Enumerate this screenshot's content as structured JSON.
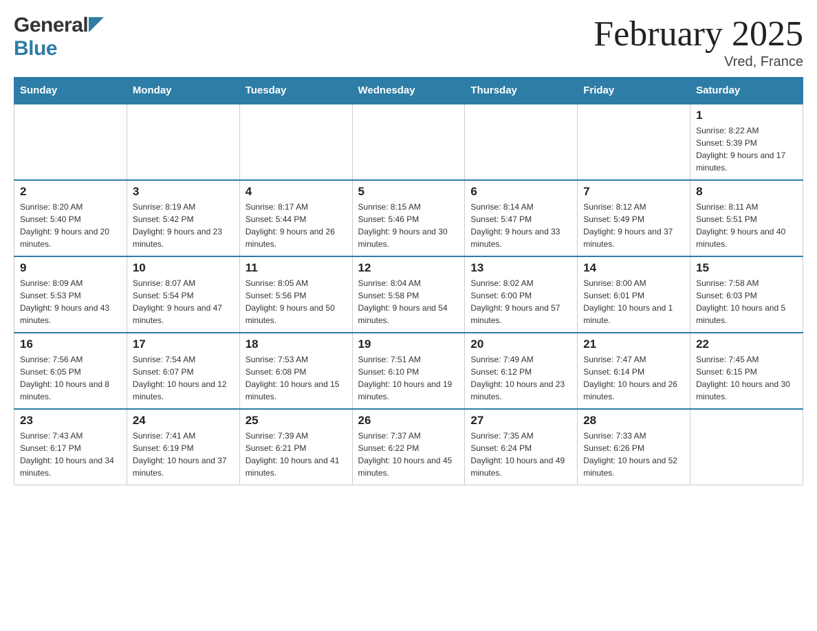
{
  "header": {
    "logo_general": "General",
    "logo_blue": "Blue",
    "month_title": "February 2025",
    "location": "Vred, France"
  },
  "days_of_week": [
    "Sunday",
    "Monday",
    "Tuesday",
    "Wednesday",
    "Thursday",
    "Friday",
    "Saturday"
  ],
  "weeks": [
    [
      {
        "day": "",
        "info": ""
      },
      {
        "day": "",
        "info": ""
      },
      {
        "day": "",
        "info": ""
      },
      {
        "day": "",
        "info": ""
      },
      {
        "day": "",
        "info": ""
      },
      {
        "day": "",
        "info": ""
      },
      {
        "day": "1",
        "info": "Sunrise: 8:22 AM\nSunset: 5:39 PM\nDaylight: 9 hours and 17 minutes."
      }
    ],
    [
      {
        "day": "2",
        "info": "Sunrise: 8:20 AM\nSunset: 5:40 PM\nDaylight: 9 hours and 20 minutes."
      },
      {
        "day": "3",
        "info": "Sunrise: 8:19 AM\nSunset: 5:42 PM\nDaylight: 9 hours and 23 minutes."
      },
      {
        "day": "4",
        "info": "Sunrise: 8:17 AM\nSunset: 5:44 PM\nDaylight: 9 hours and 26 minutes."
      },
      {
        "day": "5",
        "info": "Sunrise: 8:15 AM\nSunset: 5:46 PM\nDaylight: 9 hours and 30 minutes."
      },
      {
        "day": "6",
        "info": "Sunrise: 8:14 AM\nSunset: 5:47 PM\nDaylight: 9 hours and 33 minutes."
      },
      {
        "day": "7",
        "info": "Sunrise: 8:12 AM\nSunset: 5:49 PM\nDaylight: 9 hours and 37 minutes."
      },
      {
        "day": "8",
        "info": "Sunrise: 8:11 AM\nSunset: 5:51 PM\nDaylight: 9 hours and 40 minutes."
      }
    ],
    [
      {
        "day": "9",
        "info": "Sunrise: 8:09 AM\nSunset: 5:53 PM\nDaylight: 9 hours and 43 minutes."
      },
      {
        "day": "10",
        "info": "Sunrise: 8:07 AM\nSunset: 5:54 PM\nDaylight: 9 hours and 47 minutes."
      },
      {
        "day": "11",
        "info": "Sunrise: 8:05 AM\nSunset: 5:56 PM\nDaylight: 9 hours and 50 minutes."
      },
      {
        "day": "12",
        "info": "Sunrise: 8:04 AM\nSunset: 5:58 PM\nDaylight: 9 hours and 54 minutes."
      },
      {
        "day": "13",
        "info": "Sunrise: 8:02 AM\nSunset: 6:00 PM\nDaylight: 9 hours and 57 minutes."
      },
      {
        "day": "14",
        "info": "Sunrise: 8:00 AM\nSunset: 6:01 PM\nDaylight: 10 hours and 1 minute."
      },
      {
        "day": "15",
        "info": "Sunrise: 7:58 AM\nSunset: 6:03 PM\nDaylight: 10 hours and 5 minutes."
      }
    ],
    [
      {
        "day": "16",
        "info": "Sunrise: 7:56 AM\nSunset: 6:05 PM\nDaylight: 10 hours and 8 minutes."
      },
      {
        "day": "17",
        "info": "Sunrise: 7:54 AM\nSunset: 6:07 PM\nDaylight: 10 hours and 12 minutes."
      },
      {
        "day": "18",
        "info": "Sunrise: 7:53 AM\nSunset: 6:08 PM\nDaylight: 10 hours and 15 minutes."
      },
      {
        "day": "19",
        "info": "Sunrise: 7:51 AM\nSunset: 6:10 PM\nDaylight: 10 hours and 19 minutes."
      },
      {
        "day": "20",
        "info": "Sunrise: 7:49 AM\nSunset: 6:12 PM\nDaylight: 10 hours and 23 minutes."
      },
      {
        "day": "21",
        "info": "Sunrise: 7:47 AM\nSunset: 6:14 PM\nDaylight: 10 hours and 26 minutes."
      },
      {
        "day": "22",
        "info": "Sunrise: 7:45 AM\nSunset: 6:15 PM\nDaylight: 10 hours and 30 minutes."
      }
    ],
    [
      {
        "day": "23",
        "info": "Sunrise: 7:43 AM\nSunset: 6:17 PM\nDaylight: 10 hours and 34 minutes."
      },
      {
        "day": "24",
        "info": "Sunrise: 7:41 AM\nSunset: 6:19 PM\nDaylight: 10 hours and 37 minutes."
      },
      {
        "day": "25",
        "info": "Sunrise: 7:39 AM\nSunset: 6:21 PM\nDaylight: 10 hours and 41 minutes."
      },
      {
        "day": "26",
        "info": "Sunrise: 7:37 AM\nSunset: 6:22 PM\nDaylight: 10 hours and 45 minutes."
      },
      {
        "day": "27",
        "info": "Sunrise: 7:35 AM\nSunset: 6:24 PM\nDaylight: 10 hours and 49 minutes."
      },
      {
        "day": "28",
        "info": "Sunrise: 7:33 AM\nSunset: 6:26 PM\nDaylight: 10 hours and 52 minutes."
      },
      {
        "day": "",
        "info": ""
      }
    ]
  ]
}
